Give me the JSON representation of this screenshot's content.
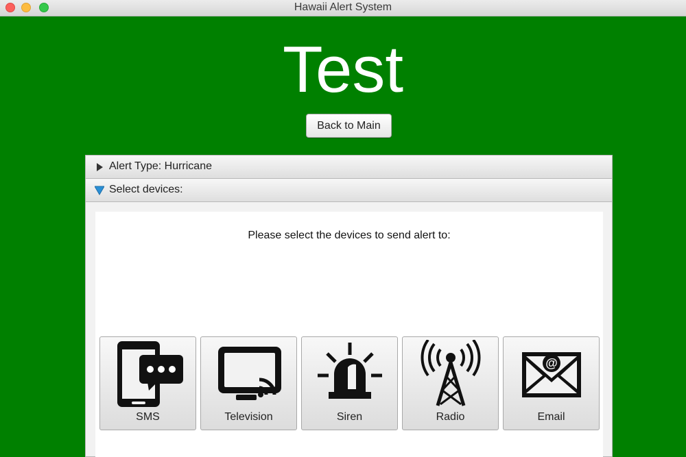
{
  "window": {
    "title": "Hawaii Alert System"
  },
  "page": {
    "title": "Test",
    "back_button": "Back to Main"
  },
  "accordion": {
    "alert_type_label": "Alert Type: Hurricane",
    "select_devices_label": "Select devices:",
    "instructions": "Please select the devices to send alert to:"
  },
  "devices": [
    {
      "label": "SMS",
      "icon": "sms-phone-chat-icon"
    },
    {
      "label": "Television",
      "icon": "television-cast-icon"
    },
    {
      "label": "Siren",
      "icon": "siren-icon"
    },
    {
      "label": "Radio",
      "icon": "radio-tower-icon"
    },
    {
      "label": "Email",
      "icon": "email-envelope-icon"
    }
  ],
  "colors": {
    "background": "#008000",
    "panel": "#f2f2f2",
    "accent_arrow": "#2a8fd6"
  }
}
